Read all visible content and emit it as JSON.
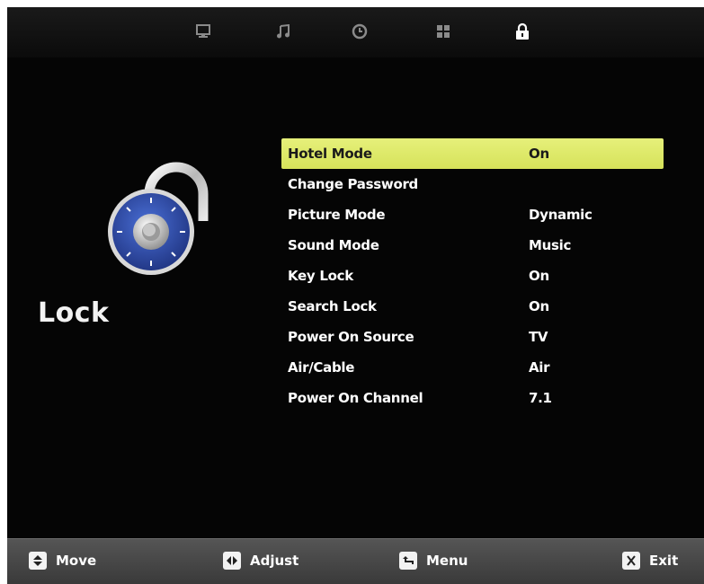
{
  "tabs": [
    {
      "icon": "monitor-icon",
      "active": false
    },
    {
      "icon": "music-note-icon",
      "active": false
    },
    {
      "icon": "clock-icon",
      "active": false
    },
    {
      "icon": "grid-icon",
      "active": false
    },
    {
      "icon": "lock-icon",
      "active": true
    }
  ],
  "panel": {
    "title": "Lock",
    "icon": "padlock-icon"
  },
  "menu": {
    "selected_index": 0,
    "items": [
      {
        "label": "Hotel Mode",
        "value": "On"
      },
      {
        "label": "Change Password",
        "value": ""
      },
      {
        "label": "Picture Mode",
        "value": "Dynamic"
      },
      {
        "label": "Sound Mode",
        "value": "Music"
      },
      {
        "label": "Key Lock",
        "value": "On"
      },
      {
        "label": "Search Lock",
        "value": "On"
      },
      {
        "label": "Power On Source",
        "value": "TV"
      },
      {
        "label": "Air/Cable",
        "value": "Air"
      },
      {
        "label": "Power On Channel",
        "value": "7.1"
      }
    ]
  },
  "footer": {
    "move": "Move",
    "adjust": "Adjust",
    "menu": "Menu",
    "exit": "Exit"
  },
  "colors": {
    "highlight": "#dfe968",
    "background": "#050505",
    "footer": "#4a4a4a",
    "padlock_dial": "#2f4fb0"
  }
}
